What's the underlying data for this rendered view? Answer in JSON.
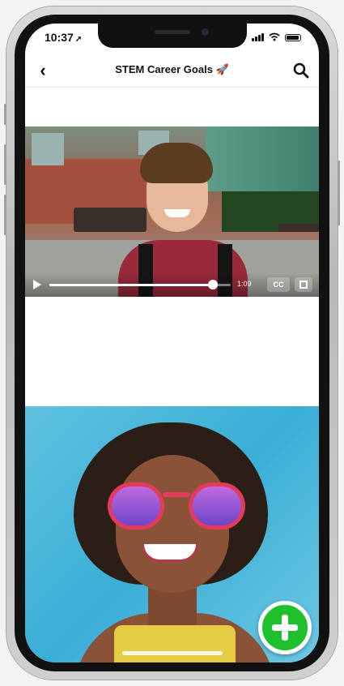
{
  "status_bar": {
    "time": "10:37",
    "location_icon": "location-arrow-icon",
    "icons": [
      "signal-bars-icon",
      "wifi-icon",
      "battery-icon"
    ]
  },
  "nav": {
    "back_icon": "chevron-left-icon",
    "title": "STEM Career Goals 🚀",
    "search_icon": "search-icon"
  },
  "feed": {
    "video": {
      "duration": "1:09",
      "progress": 0.9,
      "cc_label": "CC"
    }
  },
  "fab": {
    "icon": "plus-icon",
    "color": "#1fc02c"
  }
}
